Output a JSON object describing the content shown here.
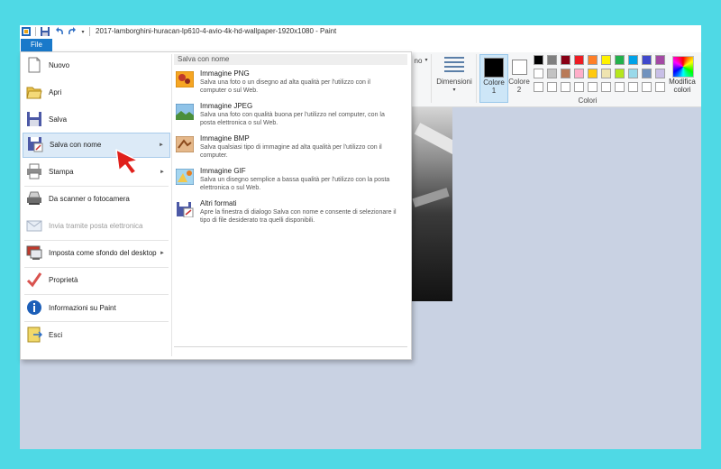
{
  "window": {
    "title": "2017-lamborghini-huracan-lp610-4-avio-4k-hd-wallpaper-1920x1080 - Paint"
  },
  "ribbon": {
    "file_tab": "File",
    "partial_label": "no",
    "dimensioni_label": "Dimensioni",
    "colore1_label": "Colore",
    "colore1_num": "1",
    "colore2_label": "Colore",
    "colore2_num": "2",
    "modifica_line1": "Modifica",
    "modifica_line2": "colori",
    "group_colori": "Colori",
    "palette_row1": [
      "#000000",
      "#7f7f7f",
      "#880015",
      "#ed1c24",
      "#ff7f27",
      "#fff200",
      "#22b14c",
      "#00a2e8",
      "#3f48cc",
      "#a349a4"
    ],
    "palette_row2": [
      "#ffffff",
      "#c3c3c3",
      "#b97a57",
      "#ffaec9",
      "#ffc90e",
      "#efe4b0",
      "#b5e61d",
      "#99d9ea",
      "#7092be",
      "#c8bfe7"
    ],
    "palette_row3": [
      "#ffffff",
      "#ffffff",
      "#ffffff",
      "#ffffff",
      "#ffffff",
      "#ffffff",
      "#ffffff",
      "#ffffff",
      "#ffffff",
      "#ffffff"
    ]
  },
  "menu": {
    "items": [
      {
        "label": "Nuovo",
        "icon": "new-file-icon"
      },
      {
        "label": "Apri",
        "icon": "open-folder-icon"
      },
      {
        "label": "Salva",
        "icon": "save-disk-icon"
      },
      {
        "label": "Salva con nome",
        "icon": "save-as-icon"
      },
      {
        "label": "Stampa",
        "icon": "printer-icon"
      },
      {
        "label": "Da scanner o fotocamera",
        "icon": "scanner-icon"
      },
      {
        "label": "Invia tramite posta elettronica",
        "icon": "email-icon"
      },
      {
        "label": "Imposta come sfondo del desktop",
        "icon": "desktop-background-icon"
      },
      {
        "label": "Proprietà",
        "icon": "properties-check-icon"
      },
      {
        "label": "Informazioni su Paint",
        "icon": "info-icon"
      },
      {
        "label": "Esci",
        "icon": "exit-icon"
      }
    ]
  },
  "submenu": {
    "title": "Salva con nome",
    "items": [
      {
        "name": "Immagine PNG",
        "desc": "Salva una foto o un disegno ad alta qualità per l'utilizzo con il computer o sul Web.",
        "icon": "png-image-icon"
      },
      {
        "name": "Immagine JPEG",
        "desc": "Salva una foto con qualità buona per l'utilizzo nel computer, con la posta elettronica o sul Web.",
        "icon": "jpeg-image-icon"
      },
      {
        "name": "Immagine BMP",
        "desc": "Salva qualsiasi tipo di immagine ad alta qualità per l'utilizzo con il computer.",
        "icon": "bmp-image-icon"
      },
      {
        "name": "Immagine GIF",
        "desc": "Salva un disegno semplice a bassa qualità per l'utilizzo con la posta elettronica o sul Web.",
        "icon": "gif-image-icon"
      },
      {
        "name": "Altri formati",
        "desc": "Apre la finestra di dialogo Salva con nome e consente di selezionare il tipo di file desiderato tra quelli disponibili.",
        "icon": "other-formats-icon"
      }
    ]
  }
}
